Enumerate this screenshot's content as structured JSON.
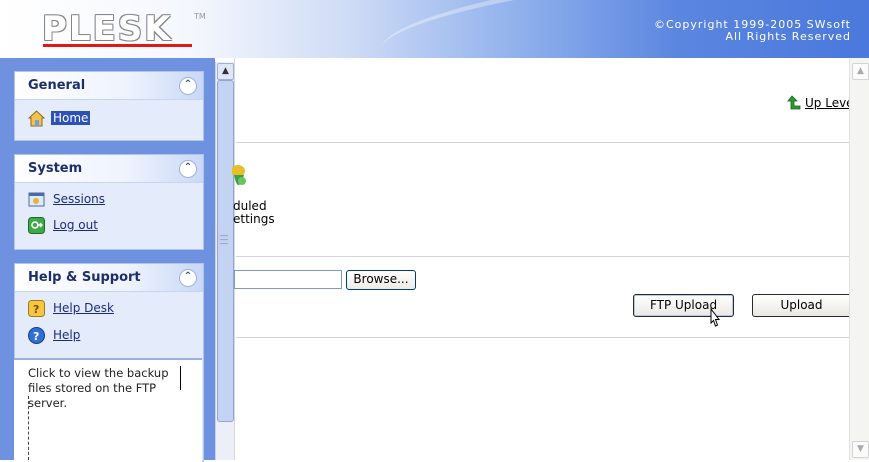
{
  "header": {
    "logo_text": "PLESK",
    "logo_tm": "TM",
    "copyright_line1": "©Copyright 1999-2005 SWsoft",
    "copyright_line2": "All Rights Reserved"
  },
  "sidebar": {
    "sections": [
      {
        "title": "General",
        "items": [
          {
            "label": "Home",
            "icon": "home-icon",
            "selected": true
          }
        ]
      },
      {
        "title": "System",
        "items": [
          {
            "label": "Sessions",
            "icon": "sessions-icon"
          },
          {
            "label": "Log out",
            "icon": "logout-icon"
          }
        ]
      },
      {
        "title": "Help & Support",
        "items": [
          {
            "label": "Help Desk",
            "icon": "help-desk-icon"
          },
          {
            "label": "Help",
            "icon": "help-icon"
          }
        ]
      }
    ],
    "help_text": "Click to view the backup files stored on the FTP server."
  },
  "main": {
    "up_level_label": "Up Level",
    "scheduled_label_line1": "duled",
    "scheduled_label_line2": "ettings",
    "file_input_value": "",
    "browse_label": "Browse...",
    "ftp_upload_label": "FTP Upload",
    "upload_label": "Upload"
  },
  "colors": {
    "nav_background": "#6f92e0",
    "logo_underline": "#e01818",
    "link": "#1a2c82"
  }
}
